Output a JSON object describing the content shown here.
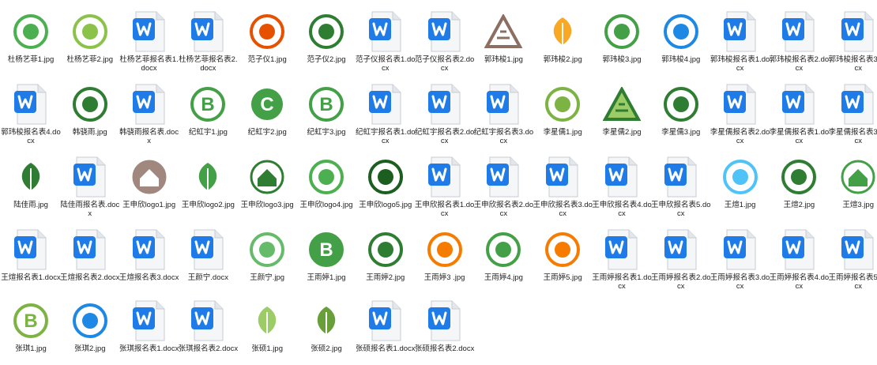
{
  "window": {
    "title": "File Explorer - icon view"
  },
  "files": [
    {
      "name": "杜杨艺菲1.jpg",
      "type": "image",
      "icon": "logo-green-circle",
      "color": "#4caf50"
    },
    {
      "name": "杜杨艺菲2.jpg",
      "type": "image",
      "icon": "logo-plug",
      "color": "#8bc34a"
    },
    {
      "name": "杜杨艺菲报名表1.docx",
      "type": "docx",
      "icon": "word-doc-icon"
    },
    {
      "name": "杜杨艺菲报名表2.docx",
      "type": "docx",
      "icon": "word-doc-icon"
    },
    {
      "name": "范子仪1.jpg",
      "type": "image",
      "icon": "logo-sunrise",
      "color": "#e65100"
    },
    {
      "name": "范子仪2.jpg",
      "type": "image",
      "icon": "logo-green-boat",
      "color": "#2e7d32"
    },
    {
      "name": "范子仪报名表1.docx",
      "type": "docx",
      "icon": "word-doc-icon"
    },
    {
      "name": "范子仪报名表2.docx",
      "type": "docx",
      "icon": "word-doc-icon"
    },
    {
      "name": "郭玮梭1.jpg",
      "type": "image",
      "icon": "logo-triangle",
      "color": "#8d6e63"
    },
    {
      "name": "郭玮梭2.jpg",
      "type": "image",
      "icon": "logo-sprout",
      "color": "#f9a825"
    },
    {
      "name": "郭玮梭3.jpg",
      "type": "image",
      "icon": "logo-lotus",
      "color": "#43a047"
    },
    {
      "name": "郭玮梭4.jpg",
      "type": "image",
      "icon": "logo-wave",
      "color": "#1e88e5"
    },
    {
      "name": "郭玮梭报名表1.docx",
      "type": "docx",
      "icon": "word-doc-icon"
    },
    {
      "name": "郭玮梭报名表2.docx",
      "type": "docx",
      "icon": "word-doc-icon"
    },
    {
      "name": "郭玮梭报名表3.docx",
      "type": "docx",
      "icon": "word-doc-icon"
    },
    {
      "name": "郭玮梭报名表4.docx",
      "type": "docx",
      "icon": "word-doc-icon"
    },
    {
      "name": "韩骁雨.jpg",
      "type": "image",
      "icon": "logo-seal",
      "color": "#2e7d32"
    },
    {
      "name": "韩骁雨报名表.docx",
      "type": "docx",
      "icon": "word-doc-icon"
    },
    {
      "name": "纪虹宇1.jpg",
      "type": "image",
      "icon": "logo-recycle-b",
      "color": "#43a047"
    },
    {
      "name": "纪虹宇2.jpg",
      "type": "image",
      "icon": "logo-c-circle",
      "color": "#43a047"
    },
    {
      "name": "纪虹宇3.jpg",
      "type": "image",
      "icon": "logo-b-box",
      "color": "#43a047"
    },
    {
      "name": "纪虹宇报名表1.docx",
      "type": "docx",
      "icon": "word-doc-icon"
    },
    {
      "name": "纪虹宇报名表2.docx",
      "type": "docx",
      "icon": "word-doc-icon"
    },
    {
      "name": "纪虹宇报名表3.docx",
      "type": "docx",
      "icon": "word-doc-icon"
    },
    {
      "name": "李星儒1.jpg",
      "type": "image",
      "icon": "logo-green-disc",
      "color": "#7cb342"
    },
    {
      "name": "李星儒2.jpg",
      "type": "image",
      "icon": "logo-warning-triangle",
      "color": "#2e7d32"
    },
    {
      "name": "李星儒3.jpg",
      "type": "image",
      "icon": "logo-ring",
      "color": "#2e7d32"
    },
    {
      "name": "李星儒报名表2.docx",
      "type": "docx",
      "icon": "word-doc-icon"
    },
    {
      "name": "李星儒报名表1.docx",
      "type": "docx",
      "icon": "word-doc-icon"
    },
    {
      "name": "李星儒报名表3.docx",
      "type": "docx",
      "icon": "word-doc-icon"
    },
    {
      "name": "陆佳雨.jpg",
      "type": "image",
      "icon": "logo-leaves",
      "color": "#2e7d32"
    },
    {
      "name": "陆佳雨报名表.docx",
      "type": "docx",
      "icon": "word-doc-icon"
    },
    {
      "name": "王申欣logo1.jpg",
      "type": "image",
      "icon": "logo-house-brown",
      "color": "#a1887f"
    },
    {
      "name": "王申欣logo2.jpg",
      "type": "image",
      "icon": "logo-leaf-green",
      "color": "#43a047"
    },
    {
      "name": "王申欣logo3.jpg",
      "type": "image",
      "icon": "logo-house-circle",
      "color": "#2e7d32"
    },
    {
      "name": "王申欣logo4.jpg",
      "type": "image",
      "icon": "logo-city-circle",
      "color": "#4caf50"
    },
    {
      "name": "王申欣logo5.jpg",
      "type": "image",
      "icon": "logo-dark-green",
      "color": "#1b5e20"
    },
    {
      "name": "王申欣报名表1.docx",
      "type": "docx",
      "icon": "word-doc-icon"
    },
    {
      "name": "王申欣报名表2.docx",
      "type": "docx",
      "icon": "word-doc-icon"
    },
    {
      "name": "王申欣报名表3.docx",
      "type": "docx",
      "icon": "word-doc-icon"
    },
    {
      "name": "王申欣报名表4.docx",
      "type": "docx",
      "icon": "word-doc-icon"
    },
    {
      "name": "王申欣报名表5.docx",
      "type": "docx",
      "icon": "word-doc-icon"
    },
    {
      "name": "王煊1.jpg",
      "type": "image",
      "icon": "logo-drop-tree",
      "color": "#4fc3f7"
    },
    {
      "name": "王煊2.jpg",
      "type": "image",
      "icon": "logo-lamp",
      "color": "#2e7d32"
    },
    {
      "name": "王煊3.jpg",
      "type": "image",
      "icon": "logo-house-leaf",
      "color": "#43a047"
    },
    {
      "name": "王煊报名表1.docx",
      "type": "docx",
      "icon": "word-doc-icon"
    },
    {
      "name": "王煊报名表2.docx",
      "type": "docx",
      "icon": "word-doc-icon"
    },
    {
      "name": "王煊报名表3.docx",
      "type": "docx",
      "icon": "word-doc-icon"
    },
    {
      "name": "王颜宁.docx",
      "type": "docx",
      "icon": "word-doc-icon"
    },
    {
      "name": "王颜宁.jpg",
      "type": "image",
      "icon": "logo-b-wreath",
      "color": "#66bb6a"
    },
    {
      "name": "王雨婷1.jpg",
      "type": "image",
      "icon": "logo-b-solid",
      "color": "#43a047"
    },
    {
      "name": "王雨婷2.jpg",
      "type": "image",
      "icon": "logo-boat-swirl",
      "color": "#2e7d32"
    },
    {
      "name": "王雨婷3 .jpg",
      "type": "image",
      "icon": "logo-people",
      "color": "#f57c00"
    },
    {
      "name": "王雨婷4.jpg",
      "type": "image",
      "icon": "logo-green-swirl",
      "color": "#43a047"
    },
    {
      "name": "王雨婷5.jpg",
      "type": "image",
      "icon": "logo-apple",
      "color": "#f57c00"
    },
    {
      "name": "王雨婷报名表1.docx",
      "type": "docx",
      "icon": "word-doc-icon"
    },
    {
      "name": "王雨婷报名表2.docx",
      "type": "docx",
      "icon": "word-doc-icon"
    },
    {
      "name": "王雨婷报名表3.docx",
      "type": "docx",
      "icon": "word-doc-icon"
    },
    {
      "name": "王雨婷报名表4.docx",
      "type": "docx",
      "icon": "word-doc-icon"
    },
    {
      "name": "王雨婷报名表5.docx",
      "type": "docx",
      "icon": "word-doc-icon"
    },
    {
      "name": "张琪1.jpg",
      "type": "image",
      "icon": "logo-b-leaf",
      "color": "#7cb342"
    },
    {
      "name": "张琪2.jpg",
      "type": "image",
      "icon": "logo-blue-figure",
      "color": "#1e88e5"
    },
    {
      "name": "张琪报名表1.docx",
      "type": "docx",
      "icon": "word-doc-icon"
    },
    {
      "name": "张琪报名表2.docx",
      "type": "docx",
      "icon": "word-doc-icon"
    },
    {
      "name": "张硕1.jpg",
      "type": "image",
      "icon": "logo-swoosh",
      "color": "#9ccc65"
    },
    {
      "name": "张硕2.jpg",
      "type": "image",
      "icon": "logo-leaf-hands",
      "color": "#689f38"
    },
    {
      "name": "张硕报名表1.docx",
      "type": "docx",
      "icon": "word-doc-icon"
    },
    {
      "name": "张硕报名表2.docx",
      "type": "docx",
      "icon": "word-doc-icon"
    }
  ]
}
